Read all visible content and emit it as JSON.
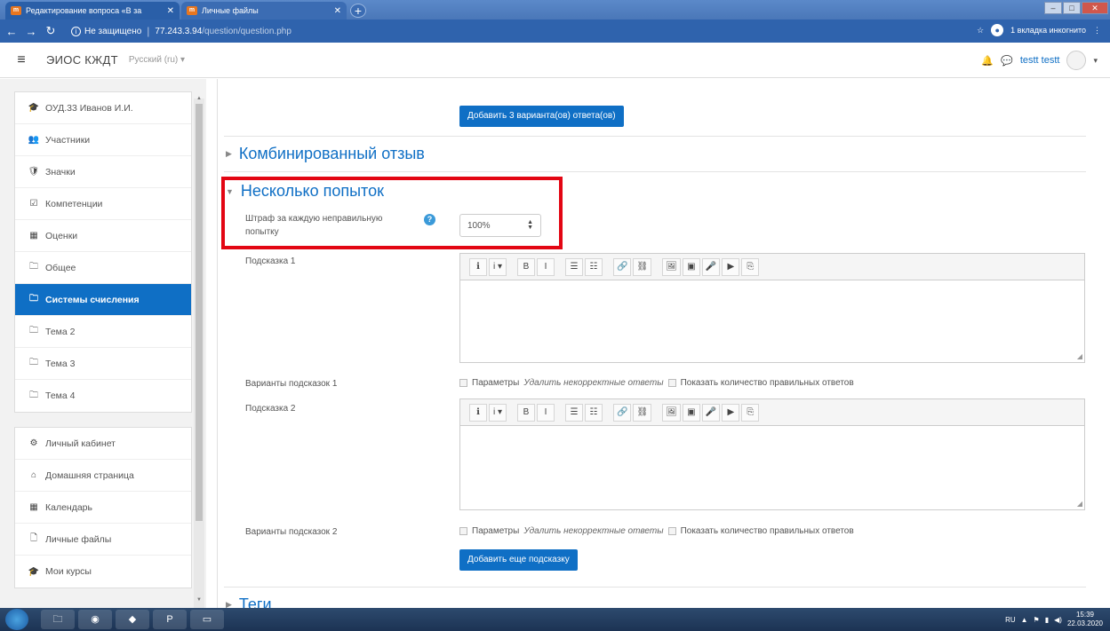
{
  "browser": {
    "tabs": [
      {
        "title": "Редактирование вопроса «В за",
        "active": true
      },
      {
        "title": "Личные файлы",
        "active": false
      }
    ],
    "security_label": "Не защищено",
    "url_host": "77.243.3.94",
    "url_path": "/question/question.php",
    "incognito_label": "1 вкладка инкогнито"
  },
  "navbar": {
    "site_name": "ЭИОС КЖДТ",
    "language": "Русский (ru)",
    "user_name": "testt testt"
  },
  "sidebar": {
    "course_items": [
      {
        "label": "ОУД.33 Иванов И.И.",
        "icon": "graduation-cap-icon",
        "glyph": "🎓",
        "active": false
      },
      {
        "label": "Участники",
        "icon": "users-icon",
        "glyph": "👥",
        "active": false
      },
      {
        "label": "Значки",
        "icon": "badge-icon",
        "glyph": "🛡",
        "active": false
      },
      {
        "label": "Компетенции",
        "icon": "checkbox-icon",
        "glyph": "☑",
        "active": false
      },
      {
        "label": "Оценки",
        "icon": "table-icon",
        "glyph": "▦",
        "active": false
      },
      {
        "label": "Общее",
        "icon": "folder-icon",
        "glyph": "🗀",
        "active": false
      },
      {
        "label": "Системы счисления",
        "icon": "folder-icon",
        "glyph": "🗀",
        "active": true
      },
      {
        "label": "Тема 2",
        "icon": "folder-icon",
        "glyph": "🗀",
        "active": false
      },
      {
        "label": "Тема 3",
        "icon": "folder-icon",
        "glyph": "🗀",
        "active": false
      },
      {
        "label": "Тема 4",
        "icon": "folder-icon",
        "glyph": "🗀",
        "active": false
      }
    ],
    "site_items": [
      {
        "label": "Личный кабинет",
        "icon": "dashboard-icon",
        "glyph": "⚙",
        "active": false
      },
      {
        "label": "Домашняя страница",
        "icon": "home-icon",
        "glyph": "⌂",
        "active": false
      },
      {
        "label": "Календарь",
        "icon": "calendar-icon",
        "glyph": "▦",
        "active": false
      },
      {
        "label": "Личные файлы",
        "icon": "file-icon",
        "glyph": "🗋",
        "active": false
      },
      {
        "label": "Мои курсы",
        "icon": "graduation-cap-icon",
        "glyph": "🎓",
        "active": false
      }
    ]
  },
  "main": {
    "add_answers_button": "Добавить 3 варианта(ов) ответа(ов)",
    "combined_feedback_title": "Комбинированный отзыв",
    "multiple_tries_title": "Несколько попыток",
    "penalty_label": "Штраф за каждую неправильную попытку",
    "penalty_value": "100%",
    "hint1_label": "Подсказка 1",
    "hint1_options_label": "Варианты подсказок 1",
    "hint2_label": "Подсказка 2",
    "hint2_options_label": "Варианты подсказок 2",
    "opt_params": "Параметры",
    "opt_clear_wrong": "Удалить некорректные ответы",
    "opt_show_num_correct": "Показать количество правильных ответов",
    "add_hint_button": "Добавить еще подсказку",
    "tags_title": "Теги"
  },
  "editor_toolbar": [
    "ℹ",
    "i ▾",
    "B",
    "I",
    "☰",
    "☷",
    "🔗",
    "⛓",
    "🖼",
    "▣",
    "🎤",
    "▶",
    "⎘"
  ],
  "taskbar": {
    "lang": "RU",
    "time": "15:39",
    "date": "22.03.2020"
  },
  "colors": {
    "accent": "#0f6fc5",
    "highlight": "#e30613"
  }
}
